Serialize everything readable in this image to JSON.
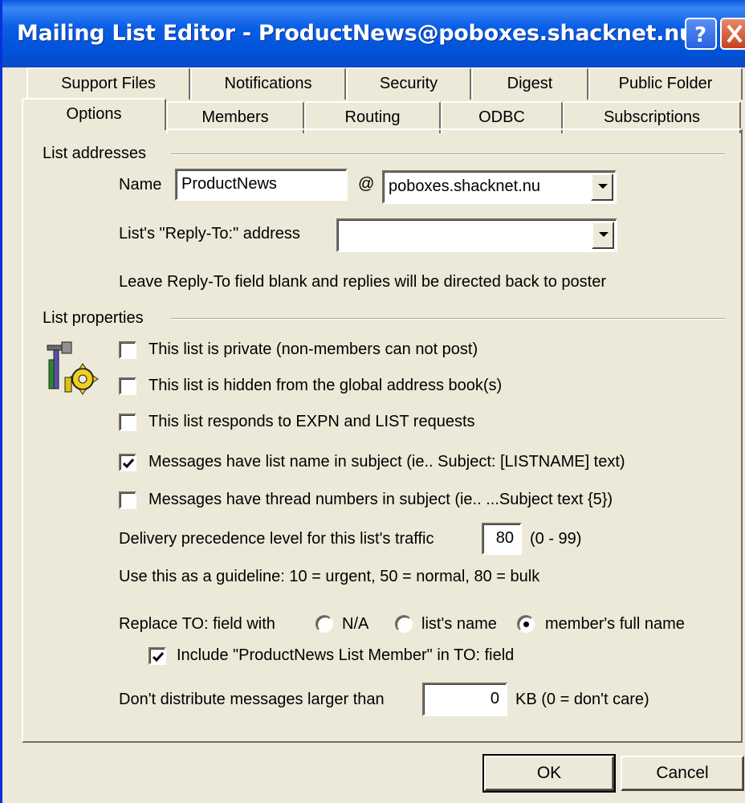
{
  "window": {
    "title": "Mailing List Editor - ProductNews@poboxes.shacknet.nu"
  },
  "tabs": {
    "back_row": [
      "Support Files",
      "Notifications",
      "Security",
      "Digest",
      "Public Folder"
    ],
    "front_row": [
      "Options",
      "Members",
      "Routing",
      "ODBC",
      "Subscriptions"
    ],
    "active": "Options"
  },
  "list_addresses": {
    "group_label": "List addresses",
    "name_label": "Name",
    "name_value": "ProductNews",
    "at_sign": "@",
    "domain_value": "poboxes.shacknet.nu",
    "reply_to_label": "List's \"Reply-To:\" address",
    "reply_to_value": "",
    "reply_to_hint": "Leave Reply-To field blank and replies will be directed back to poster"
  },
  "list_properties": {
    "group_label": "List properties",
    "options": [
      {
        "label": "This list is private (non-members can not post)",
        "checked": false
      },
      {
        "label": "This list is hidden from the global address book(s)",
        "checked": false
      },
      {
        "label": "This list responds to EXPN and LIST requests",
        "checked": false
      },
      {
        "label": "Messages have list name in subject (ie.. Subject: [LISTNAME] text)",
        "checked": true
      },
      {
        "label": "Messages have thread numbers in subject (ie.. ...Subject text {5})",
        "checked": false
      }
    ],
    "precedence_label": "Delivery precedence level for this list's traffic",
    "precedence_value": "80",
    "precedence_range": "(0 - 99)",
    "guideline": "Use this as a guideline: 10 = urgent, 50 = normal, 80 = bulk",
    "replace_to_label": "Replace TO: field with",
    "replace_to_options": [
      "N/A",
      "list's name",
      "member's full name"
    ],
    "replace_to_selected": "member's full name",
    "include_label": "Include \"ProductNews List Member\" in TO: field",
    "include_checked": true,
    "size_label": "Don't distribute messages larger than",
    "size_value": "0",
    "size_unit": "KB (0 = don't care)"
  },
  "footer": {
    "ok_label": "OK",
    "cancel_label": "Cancel"
  },
  "icons": {
    "properties_icon": "tools-gear-icon",
    "help": "help-icon",
    "close": "close-icon"
  }
}
